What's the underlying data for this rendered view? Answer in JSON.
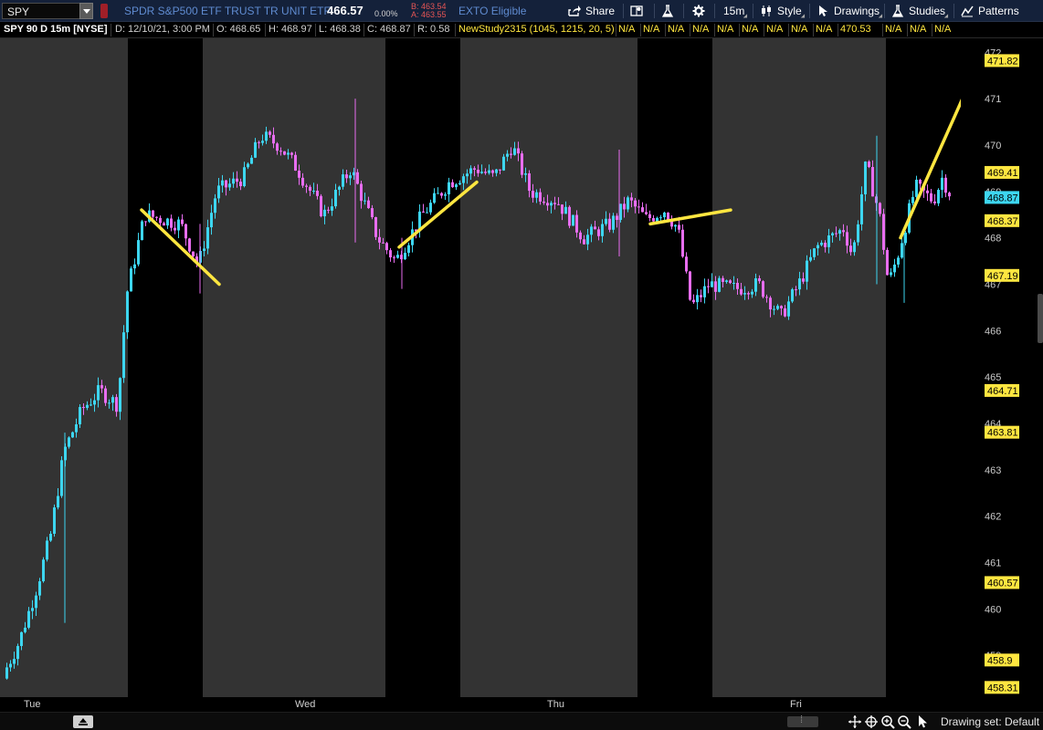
{
  "toolbar": {
    "symbol": "SPY",
    "description": "SPDR S&P500 ETF TRUST TR UNIT ETF",
    "last_price": "466.57",
    "change_pct": "0.00%",
    "bid": "B: 463.54",
    "ask": "A: 463.55",
    "status": "EXTO Eligible",
    "share_label": "Share",
    "interval_label": "15m",
    "style_label": "Style",
    "drawings_label": "Drawings",
    "studies_label": "Studies",
    "patterns_label": "Patterns",
    "colors": {
      "bg": "#14213a",
      "link": "#5f8bd0",
      "flag": "#a01f28"
    }
  },
  "info_bar": {
    "title": "SPY 90 D 15m [NYSE]",
    "date": "D: 12/10/21, 3:00 PM",
    "open": "O: 468.65",
    "high": "H: 468.97",
    "low": "L: 468.38",
    "close": "C: 468.87",
    "range": "R: 0.58",
    "study": "NewStudy2315 (1045, 1215, 20, 5)",
    "study_values": [
      "N/A",
      "N/A",
      "N/A",
      "N/A",
      "N/A",
      "N/A",
      "N/A",
      "N/A",
      "N/A",
      "470.53",
      "N/A",
      "N/A",
      "N/A"
    ]
  },
  "chart_data": {
    "type": "candlestick",
    "title": "SPY 90 D 15m [NYSE]",
    "x_days": [
      "Tue",
      "Wed",
      "Thu",
      "Fri"
    ],
    "ylim": [
      458.1,
      472.3
    ],
    "y_ticks": [
      "459",
      "460",
      "461",
      "462",
      "463",
      "464",
      "465",
      "466",
      "467",
      "468",
      "469",
      "470",
      "471",
      "472"
    ],
    "price_markers": [
      {
        "value": "471.82",
        "bg": "#ffe640",
        "fg": "#000000"
      },
      {
        "value": "469.41",
        "bg": "#ffe640",
        "fg": "#000000"
      },
      {
        "value": "468.87",
        "bg": "#3dd6f0",
        "fg": "#000000"
      },
      {
        "value": "468.37",
        "bg": "#ffe640",
        "fg": "#000000"
      },
      {
        "value": "467.19",
        "bg": "#ffe640",
        "fg": "#000000"
      },
      {
        "value": "464.71",
        "bg": "#ffe640",
        "fg": "#000000"
      },
      {
        "value": "463.81",
        "bg": "#ffe640",
        "fg": "#000000"
      },
      {
        "value": "460.57",
        "bg": "#ffe640",
        "fg": "#000000"
      },
      {
        "value": "458.9",
        "bg": "#ffe640",
        "fg": "#000000"
      },
      {
        "value": "458.31",
        "bg": "#ffe640",
        "fg": "#000000"
      }
    ],
    "close_path": [
      [
        0,
        458.5
      ],
      [
        0.02,
        459.3
      ],
      [
        0.04,
        460.5
      ],
      [
        0.055,
        461.6
      ],
      [
        0.07,
        463.4
      ],
      [
        0.09,
        464.3
      ],
      [
        0.11,
        464.7
      ],
      [
        0.13,
        464.4
      ],
      [
        0.14,
        466.8
      ],
      [
        0.16,
        468.5
      ],
      [
        0.2,
        468.3
      ],
      [
        0.22,
        467.4
      ],
      [
        0.24,
        469.0
      ],
      [
        0.27,
        469.3
      ],
      [
        0.29,
        470.2
      ],
      [
        0.31,
        470.0
      ],
      [
        0.33,
        469.5
      ],
      [
        0.36,
        468.5
      ],
      [
        0.39,
        469.5
      ],
      [
        0.42,
        468.0
      ],
      [
        0.44,
        467.5
      ],
      [
        0.47,
        468.5
      ],
      [
        0.5,
        469.2
      ],
      [
        0.53,
        469.5
      ],
      [
        0.55,
        469.3
      ],
      [
        0.57,
        470.0
      ],
      [
        0.59,
        469.0
      ],
      [
        0.62,
        468.8
      ],
      [
        0.65,
        468.0
      ],
      [
        0.68,
        468.3
      ],
      [
        0.7,
        468.8
      ],
      [
        0.72,
        468.4
      ],
      [
        0.74,
        468.6
      ],
      [
        0.755,
        468.2
      ],
      [
        0.77,
        466.5
      ],
      [
        0.79,
        467.0
      ],
      [
        0.82,
        466.9
      ],
      [
        0.845,
        467.0
      ],
      [
        0.87,
        466.3
      ],
      [
        0.89,
        467.0
      ],
      [
        0.91,
        467.8
      ],
      [
        0.94,
        468.2
      ],
      [
        0.95,
        467.6
      ],
      [
        0.965,
        469.6
      ],
      [
        0.98,
        468.5
      ],
      [
        0.99,
        467.0
      ],
      [
        1.0,
        467.6
      ],
      [
        1.02,
        469.1
      ],
      [
        1.04,
        468.8
      ],
      [
        1.05,
        469.3
      ],
      [
        1.06,
        468.9
      ]
    ],
    "colors": {
      "up": "#3dd6f0",
      "down": "#e86df0",
      "bg": "#333333",
      "session_shade": "#000000",
      "drawing": "#ffe640"
    }
  },
  "bottom_bar": {
    "drawing_set": "Drawing set: Default"
  }
}
